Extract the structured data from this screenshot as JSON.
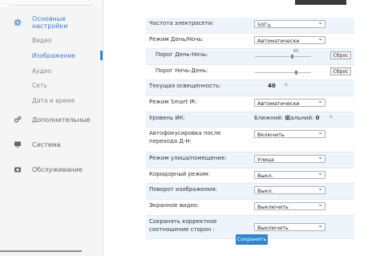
{
  "sidebar": {
    "sections": [
      {
        "label": "Основные настройки",
        "icon": "gear-icon",
        "active": true
      },
      {
        "label": "Дополнительные",
        "icon": "gears-icon",
        "active": false
      },
      {
        "label": "Система",
        "icon": "monitor-icon",
        "active": false
      },
      {
        "label": "Обслуживание",
        "icon": "camera-icon",
        "active": false
      }
    ],
    "subitems": [
      "Видео",
      "Изображение",
      "Аудио",
      "Сеть",
      "Дата и время"
    ],
    "active_subitem": "Изображение"
  },
  "settings": {
    "power_frequency": {
      "label": "Частота электросети:",
      "value": "50Гц"
    },
    "day_night_mode": {
      "label": "Режим День/Ночь:",
      "value": "Автоматически"
    },
    "threshold_day_night": {
      "label": "Порог День-Ночь:",
      "value": "65",
      "reset_label": "Сброс"
    },
    "threshold_night_day": {
      "label": "Порог Ночь-День:",
      "value": "",
      "reset_label": "Сброс"
    },
    "current_illumination": {
      "label": "Текущая освещенность:",
      "value": "40"
    },
    "smart_ir_mode": {
      "label": "Режим Smart IR:",
      "value": "Автоматически"
    },
    "ir_level": {
      "label": "Уровень ИК:",
      "near_label": "Ближний:",
      "near_value": "0",
      "far_label": "Дальний:",
      "far_value": "0"
    },
    "autofocus": {
      "label": "Автофокусировка после перехода Д-Н:",
      "value": "Включить"
    },
    "street_indoor_mode": {
      "label": "Режим улица/помещение:",
      "value": "Улица"
    },
    "corridor_mode": {
      "label": "Коридорный режим:",
      "value": "Выкл."
    },
    "image_rotation": {
      "label": "Поворот изображения:",
      "value": "Выкл."
    },
    "screen_video": {
      "label": "Экранное видео:",
      "value": "Выключить"
    },
    "aspect_ratio": {
      "label": "Сохранять корректное соотношение сторон :",
      "value": "Выключить"
    }
  },
  "save_button": "Сохранить",
  "colors": {
    "accent": "#2f86d4",
    "row_alt": "#eef4fb",
    "sidebar_bg": "#f5f5f5"
  }
}
